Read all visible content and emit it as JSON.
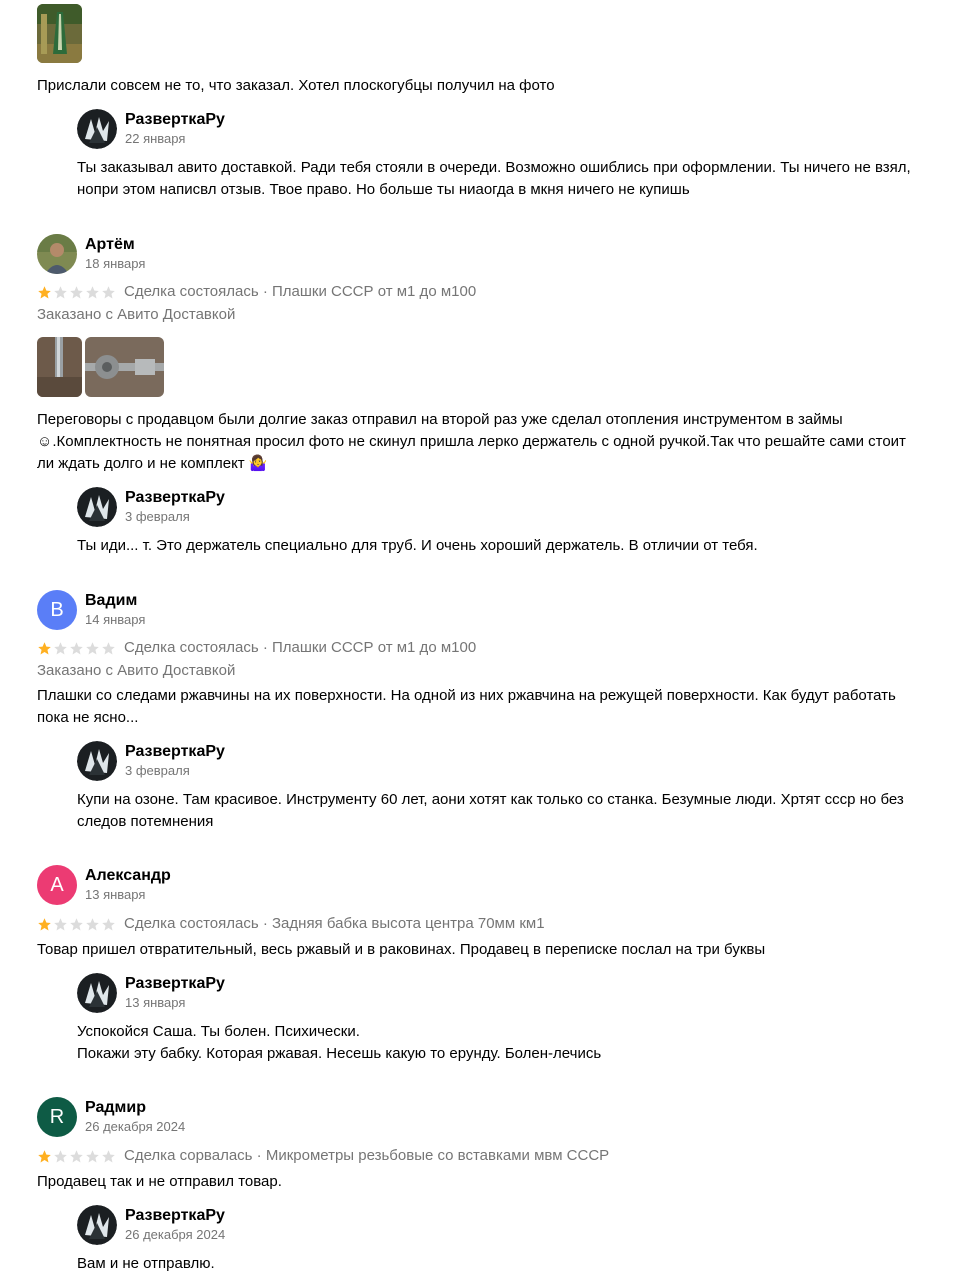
{
  "colors": {
    "star_filled": "#ffb021",
    "star_empty": "#dcdcdc",
    "meta_text": "#757575",
    "avatar_vadim": "#5a7ef7",
    "avatar_alexandr": "#ec3b73",
    "avatar_radmir": "#0e5b45"
  },
  "top_review": {
    "text": "Прислали совсем не то, что заказал. Хотел плоскогубцы получил на фото",
    "reply": {
      "author": "РазверткаРу",
      "date": "22 января",
      "text": "Ты заказывал авито доставкой. Ради тебя стояли в очереди. Возможно ошиблись при оформлении. Ты ничего не взял,\nнопри этом написвл отзыв. Твое право. Но больше ты ниаогда в мкня ничего не купишь"
    }
  },
  "reviews": [
    {
      "author": "Артём",
      "date": "18 января",
      "rating": 1,
      "meta": "Сделка состоялась · Плашки СССР от м1 до м100",
      "delivery": "Заказано с Авито Доставкой",
      "text": "Переговоры с продавцом были долгие заказ отправил на второй раз уже сделал отопления инструментом в займы\n☺.Комплектность не понятная просил фото не скинул пришла лерко держатель с одной ручкой.Так что решайте сами стоит\nли ждать долго и не комплект 🤷‍♀️",
      "reply": {
        "author": "РазверткаРу",
        "date": "3 февраля",
        "text": "Ты иди... т. Это держатель специально для труб. И очень хороший держатель. В отличии от тебя."
      }
    },
    {
      "author": "Вадим",
      "avatar_letter": "В",
      "date": "14 января",
      "rating": 1,
      "meta": "Сделка состоялась · Плашки СССР от м1 до м100",
      "delivery": "Заказано с Авито Доставкой",
      "text": "Плашки со следами ржавчины на их поверхности. На одной из них ржавчина на режущей поверхности. Как будут работать\nпока не ясно...",
      "reply": {
        "author": "РазверткаРу",
        "date": "3 февраля",
        "text": "Купи на озоне. Там красивое. Инструменту 60 лет, аони хотят как только со станка. Безумные люди. Хртят ссср но без\nследов потемнения"
      }
    },
    {
      "author": "Александр",
      "avatar_letter": "А",
      "date": "13 января",
      "rating": 1,
      "meta": "Сделка состоялась · Задняя бабка высота центра 70мм км1",
      "text": "Товар пришел отвратительный, весь ржавый и в раковинах. Продавец в переписке послал на три буквы",
      "reply": {
        "author": "РазверткаРу",
        "date": "13 января",
        "text": "Успокойся Саша. Ты болен. Психически.\nПокажи эту бабку. Которая ржавая. Несешь какую то ерунду. Болен-лечись"
      }
    },
    {
      "author": "Радмир",
      "avatar_letter": "R",
      "date": "26 декабря 2024",
      "rating": 1,
      "meta": "Сделка сорвалась · Микрометры резьбовые со вставками мвм СССР",
      "text": "Продавец так и не отправил товар.",
      "reply": {
        "author": "РазверткаРу",
        "date": "26 декабря 2024",
        "text": "Вам и не отправлю."
      }
    }
  ]
}
